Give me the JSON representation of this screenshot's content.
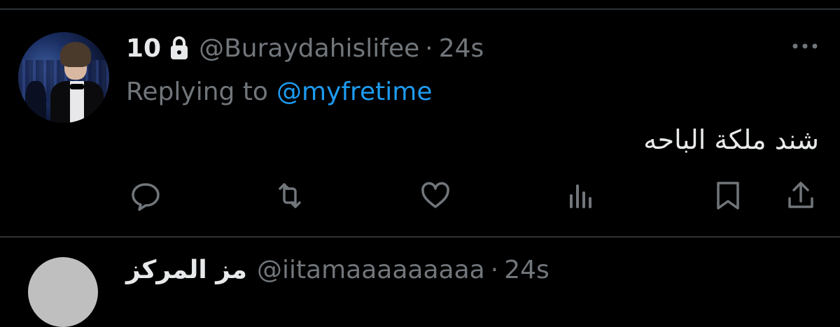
{
  "tweet": {
    "display_name": "10",
    "handle": "@Buraydahislifee",
    "separator": "·",
    "time": "24s",
    "reply_prefix": "Replying to",
    "reply_to": "@myfretime",
    "text": "شند ملكة الباحه",
    "protected_icon": "lock-icon",
    "more_icon": "more-dots-icon"
  },
  "actions": [
    {
      "name": "reply",
      "icon": "reply-icon"
    },
    {
      "name": "retweet",
      "icon": "retweet-icon"
    },
    {
      "name": "like",
      "icon": "heart-icon"
    },
    {
      "name": "views",
      "icon": "views-icon"
    },
    {
      "name": "bookmark",
      "icon": "bookmark-icon"
    },
    {
      "name": "share",
      "icon": "share-icon"
    }
  ],
  "next_tweet": {
    "display_name": "مز المركز",
    "handle": "@iitamaaaaaaaaa",
    "separator": "·",
    "time": "24s"
  },
  "colors": {
    "background": "#000000",
    "text": "#e7e9ea",
    "secondary": "#71767b",
    "link": "#1d9bf0",
    "divider": "#2f3336"
  }
}
